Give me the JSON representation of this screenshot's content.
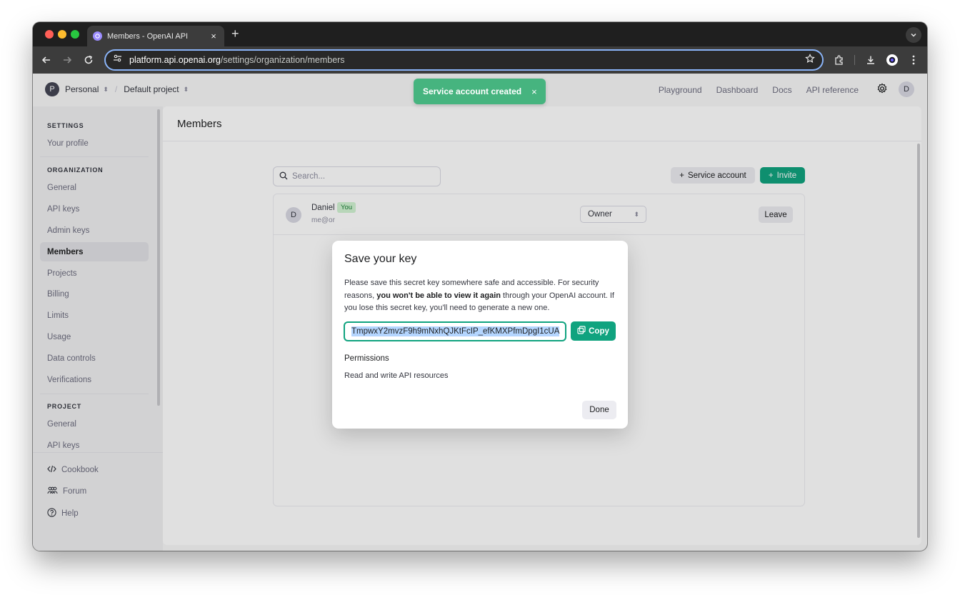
{
  "browser": {
    "tab_title": "Members - OpenAI API",
    "url_host": "platform.api.openai.org",
    "url_path": "/settings/organization/members"
  },
  "topnav": {
    "workspace_initial": "P",
    "workspace_name": "Personal",
    "project_name": "Default project",
    "links": [
      "Playground",
      "Dashboard",
      "Docs",
      "API reference"
    ],
    "user_initial": "D"
  },
  "toast": {
    "message": "Service account created",
    "close_glyph": "×"
  },
  "sidebar": {
    "settings_heading": "SETTINGS",
    "settings_items": [
      "Your profile"
    ],
    "organization_heading": "ORGANIZATION",
    "organization_items": [
      "General",
      "API keys",
      "Admin keys",
      "Members",
      "Projects",
      "Billing",
      "Limits",
      "Usage",
      "Data controls",
      "Verifications"
    ],
    "active_item": "Members",
    "project_heading": "PROJECT",
    "project_items": [
      "General",
      "API keys"
    ],
    "footer_items": [
      "Cookbook",
      "Forum",
      "Help"
    ]
  },
  "main": {
    "title": "Members",
    "search_placeholder": "Search...",
    "service_account_label": "Service account",
    "invite_label": "Invite",
    "member": {
      "initial": "D",
      "name": "Daniel",
      "badge": "You",
      "email": "me@or",
      "role": "Owner",
      "leave_label": "Leave"
    }
  },
  "modal": {
    "title": "Save your key",
    "desc_part1": "Please save this secret key somewhere safe and accessible. For security reasons, ",
    "desc_bold": "you won't be able to view it again",
    "desc_part2": " through your OpenAI account. If you lose this secret key, you'll need to generate a new one.",
    "key_value": "TmpwxY2mvzF9h9mNxhQJKtFcIP_efKMXPfmDpgI1cUA",
    "copy_label": "Copy",
    "permissions_title": "Permissions",
    "permissions_value": "Read and write API resources",
    "done_label": "Done"
  },
  "colors": {
    "accent": "#10a37f",
    "toast": "#46b47f",
    "focus_ring": "#8ab4f8"
  }
}
